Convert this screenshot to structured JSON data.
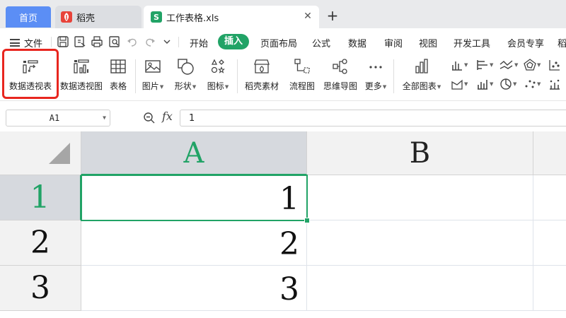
{
  "tabs": {
    "home": "首页",
    "daoke": "稻壳",
    "file": "工作表格.xls",
    "file_icon_letter": "S"
  },
  "menu": {
    "file": "文件",
    "items": [
      "开始",
      "插入",
      "页面布局",
      "公式",
      "数据",
      "审阅",
      "视图",
      "开发工具",
      "会员专享",
      "稻"
    ],
    "active": "插入"
  },
  "ribbon": {
    "pivot_table": "数据透视表",
    "pivot_chart": "数据透视图",
    "table": "表格",
    "picture": "图片",
    "shape": "形状",
    "icon": "图标",
    "daoke_material": "稻壳素材",
    "flowchart": "流程图",
    "mindmap": "思维导图",
    "more": "更多",
    "all_charts": "全部图表"
  },
  "formula_bar": {
    "name_box": "A1",
    "fx": "fx",
    "value": "1"
  },
  "sheet": {
    "columns": [
      "A",
      "B"
    ],
    "rows": [
      {
        "num": "1",
        "A": "1"
      },
      {
        "num": "2",
        "A": "2"
      },
      {
        "num": "3",
        "A": "3"
      }
    ],
    "selected_cell": "A1"
  },
  "colors": {
    "accent": "#21a366",
    "home_tab": "#5b8ef5",
    "highlight": "#e8261f"
  }
}
